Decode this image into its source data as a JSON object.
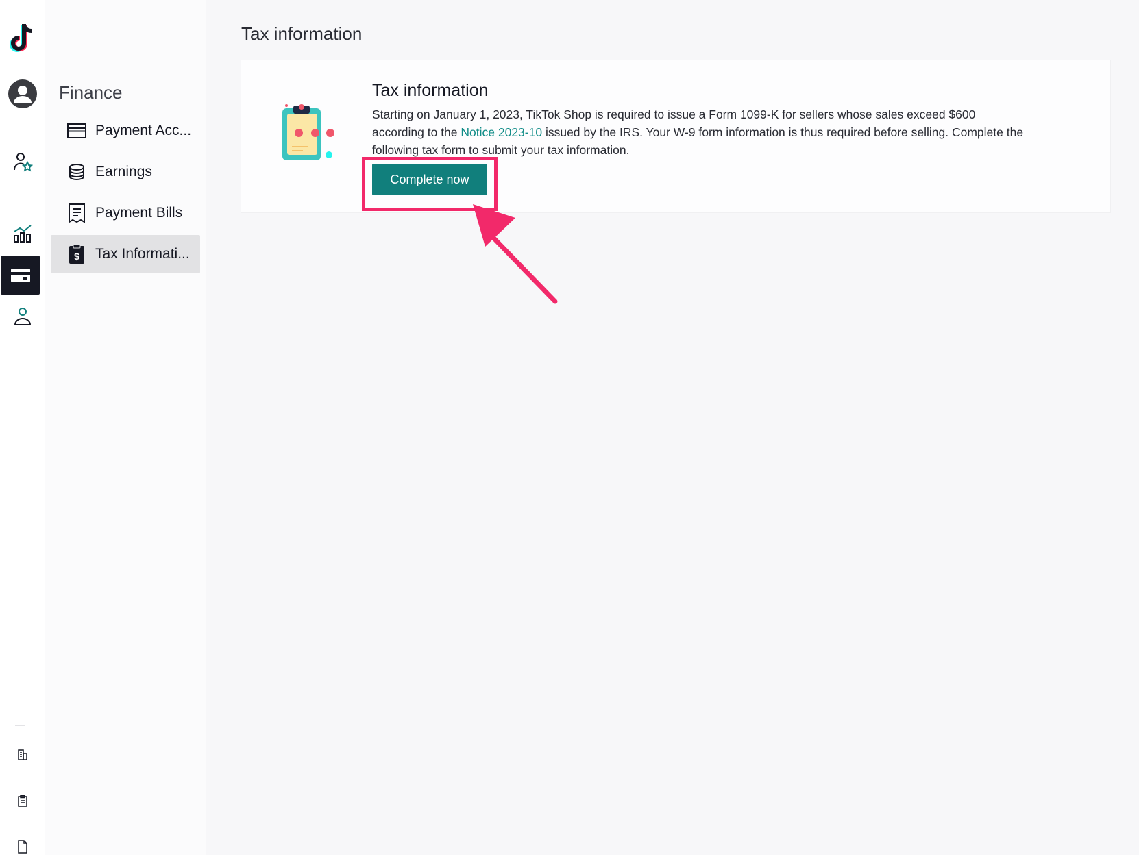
{
  "rail": {
    "logo_icon": "tiktok-logo",
    "items": [
      "avatar",
      "seller-star-icon",
      "analytics-icon",
      "card-icon",
      "user-icon",
      "building-icon",
      "clipboard-icon",
      "file-icon"
    ]
  },
  "submenu": {
    "title": "Finance",
    "items": [
      {
        "label": "Payment Acc...",
        "icon": "card-icon",
        "active": false
      },
      {
        "label": "Earnings",
        "icon": "coins-icon",
        "active": false
      },
      {
        "label": "Payment Bills",
        "icon": "receipt-icon",
        "active": false
      },
      {
        "label": "Tax Informati...",
        "icon": "dollar-doc-icon",
        "active": true
      }
    ]
  },
  "main": {
    "page_title": "Tax information",
    "card": {
      "heading": "Tax information",
      "desc_part1": "Starting on January 1, 2023, TikTok Shop is required to issue a Form 1099-K for sellers whose sales exceed $600 according to the ",
      "link_text": "Notice 2023-10",
      "desc_part2": " issued by the IRS. Your W-9 form information is thus required before selling. Complete the following tax form to submit your tax information.",
      "button_label": "Complete now"
    }
  },
  "colors": {
    "accent": "#117f7c",
    "highlight": "#f2296a",
    "link": "#108c87"
  }
}
